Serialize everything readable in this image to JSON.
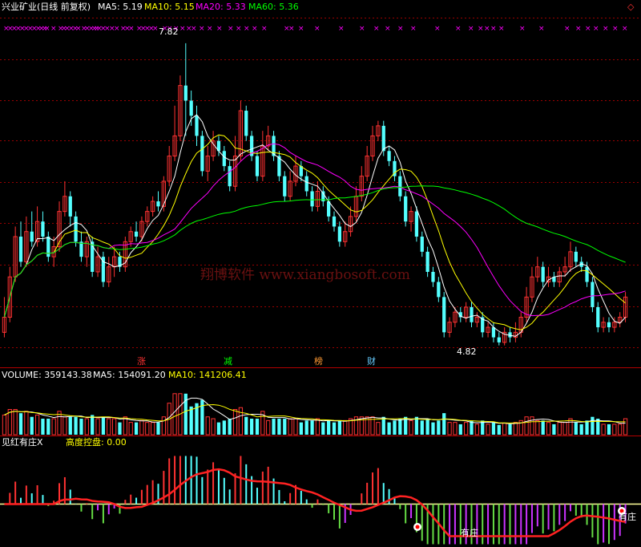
{
  "header": {
    "stock": "兴业矿业(日线 前复权)",
    "ma5": "MA5: 5.19",
    "ma10": "MA10: 5.15",
    "ma20": "MA20: 5.33",
    "ma60": "MA60: 5.36"
  },
  "annotations": {
    "high": "7.82",
    "low": "4.82",
    "watermark": "翔博软件 www.xiangbosoft.com",
    "signals": [
      "涨",
      "减",
      "榜",
      "财"
    ],
    "zhuang_label": "有庄",
    "right_diamond": "◇"
  },
  "volume_header": {
    "volume": "VOLUME: 359143.38",
    "ma5": "MA5: 154091.20",
    "ma10": "MA10: 141206.41"
  },
  "indicator_header": {
    "name": "见红有庄X",
    "control": "高度控盘: 0.00"
  },
  "colors": {
    "up": "#ff3232",
    "down": "#54ffff",
    "ma5": "#ffffff",
    "ma10": "#ffff00",
    "ma20": "#ff00ff",
    "ma60": "#00ff00",
    "grid": "#9a0000",
    "baseline": "#ffff99"
  },
  "chart_data": {
    "type": "candlestick",
    "price_range": [
      4.65,
      8.05
    ],
    "candles": [
      [
        4.95,
        5.1,
        4.9,
        5.3
      ],
      [
        5.1,
        5.5,
        5.05,
        5.6
      ],
      [
        5.5,
        5.9,
        5.45,
        6.0
      ],
      [
        5.9,
        5.65,
        5.6,
        6.05
      ],
      [
        5.65,
        5.95,
        5.6,
        6.1
      ],
      [
        5.95,
        5.85,
        5.8,
        6.15
      ],
      [
        5.85,
        6.05,
        5.8,
        6.2
      ],
      [
        6.05,
        5.9,
        5.85,
        6.15
      ],
      [
        5.9,
        5.7,
        5.65,
        5.95
      ],
      [
        5.7,
        5.8,
        5.6,
        5.9
      ],
      [
        5.8,
        6.15,
        5.75,
        6.25
      ],
      [
        6.15,
        6.3,
        6.1,
        6.45
      ],
      [
        6.3,
        6.1,
        6.0,
        6.35
      ],
      [
        6.1,
        5.85,
        5.8,
        6.15
      ],
      [
        5.85,
        5.7,
        5.65,
        5.95
      ],
      [
        5.7,
        5.85,
        5.6,
        5.9
      ],
      [
        5.85,
        5.55,
        5.5,
        5.9
      ],
      [
        5.55,
        5.7,
        5.5,
        5.8
      ],
      [
        5.7,
        5.45,
        5.4,
        5.75
      ],
      [
        5.45,
        5.6,
        5.4,
        5.7
      ],
      [
        5.6,
        5.7,
        5.5,
        5.8
      ],
      [
        5.7,
        5.6,
        5.55,
        5.75
      ],
      [
        5.6,
        5.85,
        5.55,
        5.9
      ],
      [
        5.85,
        5.95,
        5.8,
        6.0
      ],
      [
        5.95,
        5.9,
        5.85,
        6.05
      ],
      [
        5.9,
        6.05,
        5.85,
        6.1
      ],
      [
        6.05,
        6.15,
        6.0,
        6.2
      ],
      [
        6.15,
        6.25,
        6.1,
        6.3
      ],
      [
        6.25,
        6.2,
        6.15,
        6.35
      ],
      [
        6.2,
        6.45,
        6.15,
        6.5
      ],
      [
        6.45,
        6.7,
        6.4,
        6.8
      ],
      [
        6.7,
        6.9,
        6.65,
        7.2
      ],
      [
        6.9,
        7.4,
        6.85,
        7.5
      ],
      [
        7.4,
        7.25,
        6.9,
        7.82
      ],
      [
        7.25,
        7.1,
        7.0,
        7.35
      ],
      [
        7.1,
        6.9,
        6.8,
        7.2
      ],
      [
        6.9,
        6.55,
        6.5,
        6.95
      ],
      [
        6.55,
        6.7,
        6.45,
        6.8
      ],
      [
        6.7,
        6.85,
        6.65,
        6.95
      ],
      [
        6.85,
        6.75,
        6.7,
        6.9
      ],
      [
        6.75,
        6.6,
        6.55,
        6.8
      ],
      [
        6.6,
        6.4,
        6.35,
        6.65
      ],
      [
        6.4,
        6.7,
        6.35,
        6.9
      ],
      [
        6.7,
        7.15,
        6.65,
        7.25
      ],
      [
        7.15,
        6.9,
        6.85,
        7.2
      ],
      [
        6.9,
        6.7,
        6.65,
        6.95
      ],
      [
        6.7,
        6.5,
        6.45,
        6.75
      ],
      [
        6.5,
        6.8,
        6.45,
        6.95
      ],
      [
        6.8,
        6.9,
        6.75,
        7.0
      ],
      [
        6.9,
        6.7,
        6.65,
        6.95
      ],
      [
        6.7,
        6.5,
        6.45,
        6.75
      ],
      [
        6.5,
        6.3,
        6.25,
        6.55
      ],
      [
        6.3,
        6.45,
        6.25,
        6.55
      ],
      [
        6.45,
        6.6,
        6.4,
        6.7
      ],
      [
        6.6,
        6.5,
        6.45,
        6.65
      ],
      [
        6.5,
        6.35,
        6.3,
        6.55
      ],
      [
        6.35,
        6.2,
        6.15,
        6.4
      ],
      [
        6.2,
        6.35,
        6.15,
        6.45
      ],
      [
        6.35,
        6.25,
        6.2,
        6.4
      ],
      [
        6.25,
        6.1,
        6.05,
        6.3
      ],
      [
        6.1,
        6.0,
        5.95,
        6.15
      ],
      [
        6.0,
        5.85,
        5.8,
        6.05
      ],
      [
        5.85,
        5.95,
        5.8,
        6.05
      ],
      [
        5.95,
        6.1,
        5.9,
        6.2
      ],
      [
        6.1,
        6.3,
        6.05,
        6.4
      ],
      [
        6.3,
        6.5,
        6.25,
        6.6
      ],
      [
        6.5,
        6.7,
        6.45,
        6.8
      ],
      [
        6.7,
        6.9,
        6.65,
        7.0
      ],
      [
        6.9,
        7.0,
        6.85,
        7.05
      ],
      [
        7.0,
        6.75,
        6.7,
        7.05
      ],
      [
        6.75,
        6.65,
        6.6,
        6.8
      ],
      [
        6.65,
        6.5,
        6.45,
        6.7
      ],
      [
        6.5,
        6.3,
        6.25,
        6.55
      ],
      [
        6.3,
        6.05,
        6.0,
        6.35
      ],
      [
        6.05,
        6.15,
        5.95,
        6.2
      ],
      [
        6.15,
        5.9,
        5.85,
        6.2
      ],
      [
        5.9,
        5.75,
        5.7,
        5.95
      ],
      [
        5.75,
        5.55,
        5.5,
        5.8
      ],
      [
        5.55,
        5.45,
        5.4,
        5.6
      ],
      [
        5.45,
        5.3,
        5.25,
        5.5
      ],
      [
        5.3,
        4.95,
        4.9,
        5.35
      ],
      [
        4.95,
        5.05,
        4.9,
        5.1
      ],
      [
        5.05,
        5.15,
        5.0,
        5.2
      ],
      [
        5.15,
        5.1,
        5.05,
        5.2
      ],
      [
        5.1,
        5.2,
        5.05,
        5.25
      ],
      [
        5.2,
        5.05,
        5.0,
        5.25
      ],
      [
        5.05,
        5.1,
        5.0,
        5.15
      ],
      [
        5.1,
        4.95,
        4.9,
        5.15
      ],
      [
        4.95,
        5.0,
        4.9,
        5.05
      ],
      [
        5.0,
        4.9,
        4.85,
        5.05
      ],
      [
        4.9,
        4.85,
        4.82,
        4.95
      ],
      [
        4.85,
        4.95,
        4.82,
        5.0
      ],
      [
        4.95,
        4.9,
        4.85,
        5.0
      ],
      [
        4.9,
        4.95,
        4.85,
        5.05
      ],
      [
        4.95,
        5.1,
        4.9,
        5.15
      ],
      [
        5.1,
        5.3,
        5.05,
        5.4
      ],
      [
        5.3,
        5.5,
        5.25,
        5.6
      ],
      [
        5.5,
        5.6,
        5.45,
        5.7
      ],
      [
        5.6,
        5.45,
        5.4,
        5.65
      ],
      [
        5.45,
        5.5,
        5.4,
        5.6
      ],
      [
        5.5,
        5.45,
        5.4,
        5.55
      ],
      [
        5.45,
        5.55,
        5.4,
        5.6
      ],
      [
        5.55,
        5.6,
        5.5,
        5.7
      ],
      [
        5.6,
        5.75,
        5.55,
        5.85
      ],
      [
        5.75,
        5.65,
        5.6,
        5.8
      ],
      [
        5.65,
        5.6,
        5.55,
        5.7
      ],
      [
        5.6,
        5.45,
        5.4,
        5.65
      ],
      [
        5.45,
        5.2,
        5.15,
        5.5
      ],
      [
        5.2,
        5.0,
        4.95,
        5.25
      ],
      [
        5.0,
        5.05,
        4.95,
        5.1
      ],
      [
        5.05,
        5.0,
        4.95,
        5.1
      ],
      [
        5.0,
        5.05,
        4.95,
        5.1
      ],
      [
        5.05,
        5.1,
        5.0,
        5.15
      ],
      [
        5.1,
        5.3,
        5.05,
        5.35
      ]
    ],
    "ma_series": [
      "MA5",
      "MA10",
      "MA20",
      "MA60"
    ],
    "volume": {
      "max": 400000
    },
    "indicator": {
      "range": [
        -9,
        10
      ]
    }
  }
}
